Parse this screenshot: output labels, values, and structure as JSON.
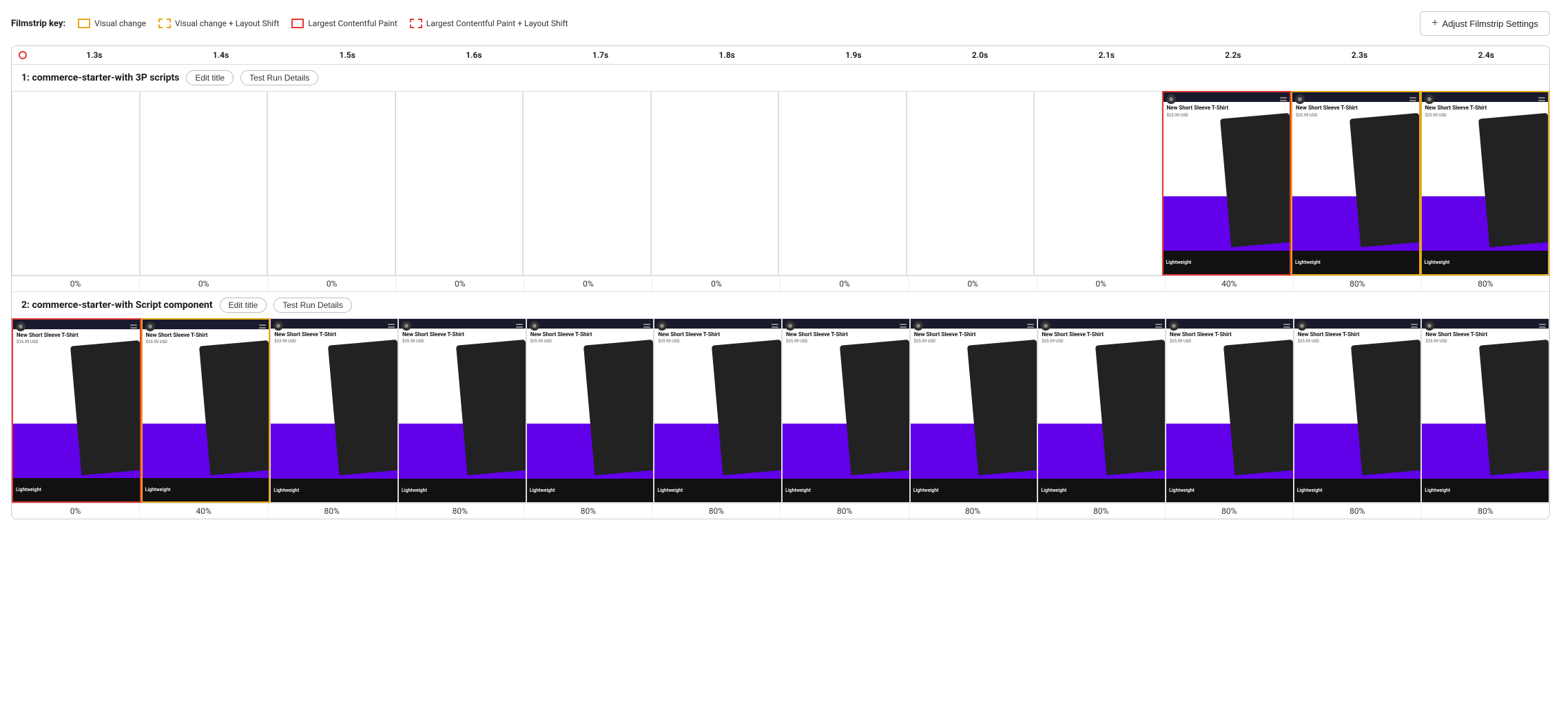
{
  "filmstrip_key": {
    "label": "Filmstrip key:",
    "items": [
      {
        "id": "visual-change",
        "label": "Visual change",
        "type": "yellow-solid"
      },
      {
        "id": "visual-change-layout-shift",
        "label": "Visual change + Layout Shift",
        "type": "yellow-dashed"
      },
      {
        "id": "lcp",
        "label": "Largest Contentful Paint",
        "type": "red-solid"
      },
      {
        "id": "lcp-layout-shift",
        "label": "Largest Contentful Paint + Layout Shift",
        "type": "red-dashed"
      }
    ]
  },
  "adjust_button": {
    "label": "Adjust Filmstrip Settings"
  },
  "timeline": {
    "ticks": [
      "1.3s",
      "1.4s",
      "1.5s",
      "1.6s",
      "1.7s",
      "1.8s",
      "1.9s",
      "2.0s",
      "2.1s",
      "2.2s",
      "2.3s",
      "2.4s"
    ]
  },
  "sections": [
    {
      "id": "section-1",
      "title": "1: commerce-starter-with 3P scripts",
      "edit_title_label": "Edit title",
      "test_run_label": "Test Run Details",
      "frames": [
        {
          "id": "f1-1",
          "type": "empty",
          "border": "none"
        },
        {
          "id": "f1-2",
          "type": "empty",
          "border": "none"
        },
        {
          "id": "f1-3",
          "type": "empty",
          "border": "none"
        },
        {
          "id": "f1-4",
          "type": "empty",
          "border": "none"
        },
        {
          "id": "f1-5",
          "type": "empty",
          "border": "none"
        },
        {
          "id": "f1-6",
          "type": "empty",
          "border": "none"
        },
        {
          "id": "f1-7",
          "type": "empty",
          "border": "none"
        },
        {
          "id": "f1-8",
          "type": "empty",
          "border": "none"
        },
        {
          "id": "f1-9",
          "type": "empty",
          "border": "none"
        },
        {
          "id": "f1-10",
          "type": "content",
          "border": "red-solid"
        },
        {
          "id": "f1-11",
          "type": "content",
          "border": "yellow-solid"
        },
        {
          "id": "f1-12",
          "type": "content",
          "border": "yellow-solid"
        }
      ],
      "scores": [
        "0%",
        "0%",
        "0%",
        "0%",
        "0%",
        "0%",
        "0%",
        "0%",
        "0%",
        "40%",
        "80%",
        "80%"
      ]
    },
    {
      "id": "section-2",
      "title": "2: commerce-starter-with Script component",
      "edit_title_label": "Edit title",
      "test_run_label": "Test Run Details",
      "frames": [
        {
          "id": "f2-1",
          "type": "content",
          "border": "red-solid"
        },
        {
          "id": "f2-2",
          "type": "content",
          "border": "yellow-solid"
        },
        {
          "id": "f2-3",
          "type": "content",
          "border": "none"
        },
        {
          "id": "f2-4",
          "type": "content",
          "border": "none"
        },
        {
          "id": "f2-5",
          "type": "content",
          "border": "none"
        },
        {
          "id": "f2-6",
          "type": "content",
          "border": "none"
        },
        {
          "id": "f2-7",
          "type": "content",
          "border": "none"
        },
        {
          "id": "f2-8",
          "type": "content",
          "border": "none"
        },
        {
          "id": "f2-9",
          "type": "content",
          "border": "none"
        },
        {
          "id": "f2-10",
          "type": "content",
          "border": "none"
        },
        {
          "id": "f2-11",
          "type": "content",
          "border": "none"
        },
        {
          "id": "f2-12",
          "type": "content",
          "border": "none"
        }
      ],
      "scores": [
        "0%",
        "40%",
        "80%",
        "80%",
        "80%",
        "80%",
        "80%",
        "80%",
        "80%",
        "80%",
        "80%",
        "80%"
      ]
    }
  ],
  "product": {
    "title": "New Short Sleeve T-Shirt",
    "price": "$25.99 USD",
    "label": "Lightweight"
  }
}
